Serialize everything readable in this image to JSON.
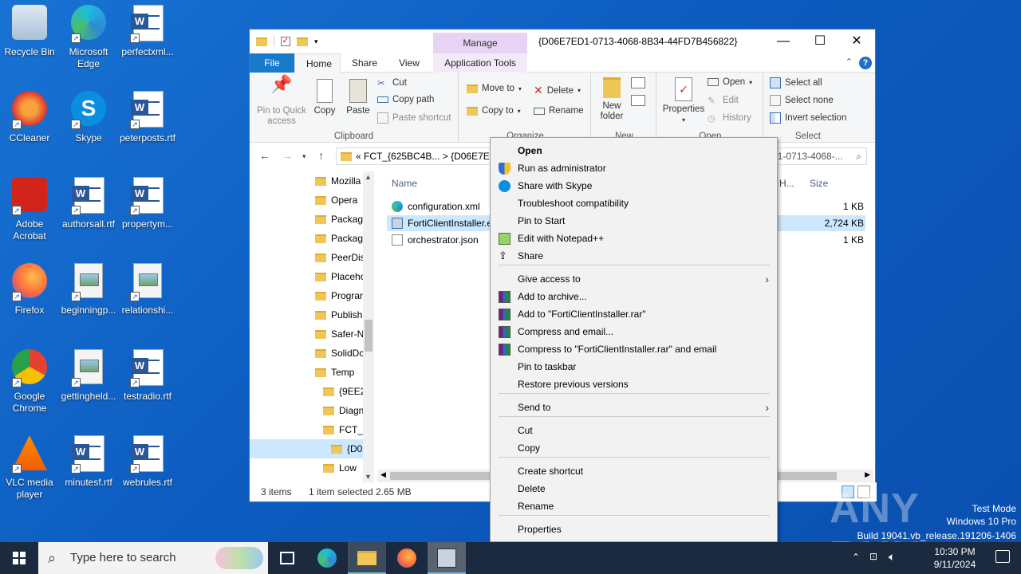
{
  "desktop": {
    "icons": [
      {
        "label": "Recycle Bin",
        "icon": "recycle-bin-icon"
      },
      {
        "label": "Microsoft Edge",
        "icon": "edge-icon"
      },
      {
        "label": "perfectxml...",
        "icon": "word-doc-icon"
      },
      {
        "label": "CCleaner",
        "icon": "ccleaner-icon"
      },
      {
        "label": "Skype",
        "icon": "skype-icon"
      },
      {
        "label": "peterposts.rtf",
        "icon": "word-doc-icon"
      },
      {
        "label": "Adobe Acrobat",
        "icon": "acrobat-icon"
      },
      {
        "label": "authorsall.rtf",
        "icon": "word-doc-icon"
      },
      {
        "label": "propertym...",
        "icon": "word-doc-icon"
      },
      {
        "label": "Firefox",
        "icon": "firefox-icon"
      },
      {
        "label": "beginningp...",
        "icon": "image-file-icon"
      },
      {
        "label": "relationshi...",
        "icon": "image-file-icon"
      },
      {
        "label": "Google Chrome",
        "icon": "chrome-icon"
      },
      {
        "label": "gettingheld...",
        "icon": "image-file-icon"
      },
      {
        "label": "testradio.rtf",
        "icon": "word-doc-icon"
      },
      {
        "label": "VLC media player",
        "icon": "vlc-icon"
      },
      {
        "label": "minutesf.rtf",
        "icon": "word-doc-icon"
      },
      {
        "label": "webrules.rtf",
        "icon": "word-doc-icon"
      }
    ]
  },
  "explorer": {
    "title": "{D06E7ED1-0713-4068-8B34-44FD7B456822}",
    "manage_label": "Manage",
    "tabs": {
      "file": "File",
      "home": "Home",
      "share": "Share",
      "view": "View",
      "app_tools": "Application Tools"
    },
    "ribbon": {
      "pin": "Pin to Quick access",
      "copy": "Copy",
      "paste": "Paste",
      "cut": "Cut",
      "copy_path": "Copy path",
      "paste_shortcut": "Paste shortcut",
      "clipboard": "Clipboard",
      "move_to": "Move to",
      "copy_to": "Copy to",
      "delete": "Delete",
      "rename": "Rename",
      "organize": "Organize",
      "new_folder": "New folder",
      "new": "New",
      "properties": "Properties",
      "open": "Open",
      "edit": "Edit",
      "history": "History",
      "open_group": "Open",
      "select_all": "Select all",
      "select_none": "Select none",
      "invert_selection": "Invert selection",
      "select": "Select"
    },
    "address": {
      "crumbs": "«  FCT_{625BC4B...  >  {D06E7ED",
      "search": "01-0713-4068-..."
    },
    "nav_items": [
      {
        "label": "Mozilla",
        "indent": 0
      },
      {
        "label": "Opera",
        "indent": 0
      },
      {
        "label": "Packag",
        "indent": 0
      },
      {
        "label": "Packag",
        "indent": 0
      },
      {
        "label": "PeerDis",
        "indent": 0
      },
      {
        "label": "Placeho",
        "indent": 0
      },
      {
        "label": "Prograr",
        "indent": 0
      },
      {
        "label": "Publish",
        "indent": 0
      },
      {
        "label": "Safer-N",
        "indent": 0
      },
      {
        "label": "SolidDc",
        "indent": 0
      },
      {
        "label": "Temp",
        "indent": 0
      },
      {
        "label": "{9EE2!",
        "indent": 1
      },
      {
        "label": "Diagn",
        "indent": 1
      },
      {
        "label": "FCT_{",
        "indent": 1
      },
      {
        "label": "{D06",
        "indent": 2
      },
      {
        "label": "Low",
        "indent": 1
      }
    ],
    "columns": {
      "name": "Name",
      "h": "H...",
      "size": "Size"
    },
    "files": [
      {
        "name": "configuration.xml",
        "size": "1 KB",
        "icon": "edge-xml-icon"
      },
      {
        "name": "FortiClientInstaller.e",
        "size": "2,724 KB",
        "icon": "installer-icon"
      },
      {
        "name": "orchestrator.json",
        "size": "1 KB",
        "icon": "json-file-icon"
      }
    ],
    "status": {
      "items": "3 items",
      "selected": "1 item selected",
      "size": "2.65 MB"
    }
  },
  "context_menu": {
    "items": [
      {
        "label": "Open",
        "bold": true,
        "icon": ""
      },
      {
        "label": "Run as administrator",
        "icon": "shield-icon"
      },
      {
        "label": "Share with Skype",
        "icon": "skype-icon"
      },
      {
        "label": "Troubleshoot compatibility",
        "icon": ""
      },
      {
        "label": "Pin to Start",
        "icon": ""
      },
      {
        "label": "Edit with Notepad++",
        "icon": "notepadpp-icon"
      },
      {
        "label": "Share",
        "icon": "share-icon"
      },
      {
        "label": "Give access to",
        "icon": "",
        "submenu": true
      },
      {
        "label": "Add to archive...",
        "icon": "winrar-icon"
      },
      {
        "label": "Add to \"FortiClientInstaller.rar\"",
        "icon": "winrar-icon"
      },
      {
        "label": "Compress and email...",
        "icon": "winrar-icon"
      },
      {
        "label": "Compress to \"FortiClientInstaller.rar\" and email",
        "icon": "winrar-icon"
      },
      {
        "label": "Pin to taskbar",
        "icon": ""
      },
      {
        "label": "Restore previous versions",
        "icon": ""
      },
      {
        "label": "Send to",
        "icon": "",
        "submenu": true
      },
      {
        "label": "Cut",
        "icon": ""
      },
      {
        "label": "Copy",
        "icon": ""
      },
      {
        "label": "Create shortcut",
        "icon": ""
      },
      {
        "label": "Delete",
        "icon": ""
      },
      {
        "label": "Rename",
        "icon": ""
      },
      {
        "label": "Properties",
        "icon": ""
      }
    ]
  },
  "taskbar": {
    "search_placeholder": "Type here to search",
    "time": "10:30 PM",
    "date": "9/11/2024"
  },
  "watermark": {
    "line1": "Test Mode",
    "line2": "Windows 10 Pro",
    "line3": "Build 19041.vb_release.191206-1406",
    "brand": "ANY RUN"
  }
}
